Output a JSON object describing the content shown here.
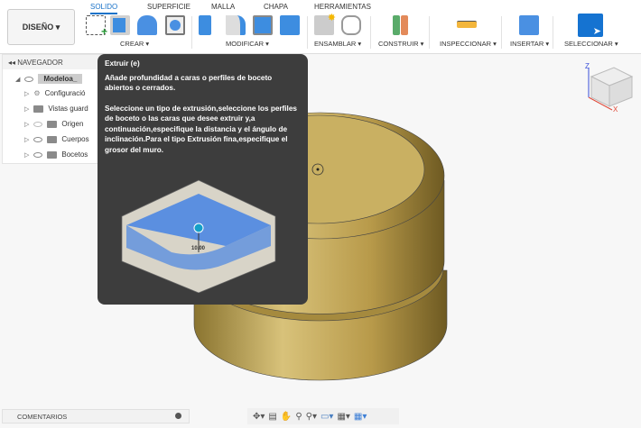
{
  "toolbar": {
    "design": "DISEÑO ▾",
    "tabs": [
      "SOLIDO",
      "SUPERFICIE",
      "MALLA",
      "CHAPA",
      "HERRAMIENTAS"
    ],
    "groups": [
      "CREAR ▾",
      "MODIFICAR ▾",
      "ENSAMBLAR ▾",
      "CONSTRUIR ▾",
      "INSPECCIONAR ▾",
      "INSERTAR ▾",
      "SELECCIONAR ▾"
    ]
  },
  "navigator": {
    "title": "NAVEGADOR",
    "items": [
      "Modeloa_",
      "Configuració",
      "Vistas guard",
      "Origen",
      "Cuerpos",
      "Bocetos"
    ]
  },
  "tooltip": {
    "title": "Extruir (e)",
    "p1": "Añade profundidad a caras o perfiles de boceto abiertos o cerrados.",
    "p2": "Seleccione un tipo de extrusión,seleccione los perfiles de boceto o las caras que desee extruir y,a continuación,especifique la distancia y el ángulo de inclinación.Para el tipo Extrusión fina,especifique el grosor del muro.",
    "dim": "10.00"
  },
  "viewcube": {
    "z": "Z",
    "x": "X"
  },
  "comments": "COMENTARIOS",
  "colors": {
    "accent": "#1a73c9",
    "tooltip": "#3d3d3d",
    "body": "#b89a4a"
  }
}
